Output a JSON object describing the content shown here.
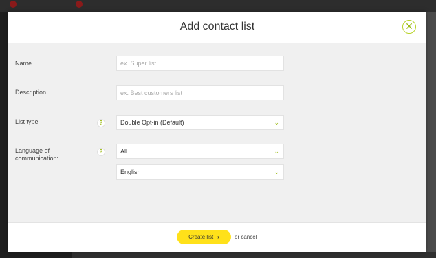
{
  "modal": {
    "title": "Add contact list",
    "close_icon": "close-icon",
    "fields": {
      "name": {
        "label": "Name",
        "placeholder": "ex. Super list",
        "value": ""
      },
      "description": {
        "label": "Description",
        "placeholder": "ex. Best customers list",
        "value": ""
      },
      "list_type": {
        "label": "List type",
        "selected": "Double Opt-in (Default)",
        "help": "?"
      },
      "language": {
        "label": "Language of communication:",
        "selected_group": "All",
        "selected_language": "English",
        "help": "?"
      }
    },
    "footer": {
      "create_label": "Create list",
      "create_arrow": "›",
      "cancel_label": "or cancel"
    }
  },
  "colors": {
    "accent": "#9cbb14",
    "button": "#ffe11a",
    "overlay": "#4b4b4b"
  }
}
